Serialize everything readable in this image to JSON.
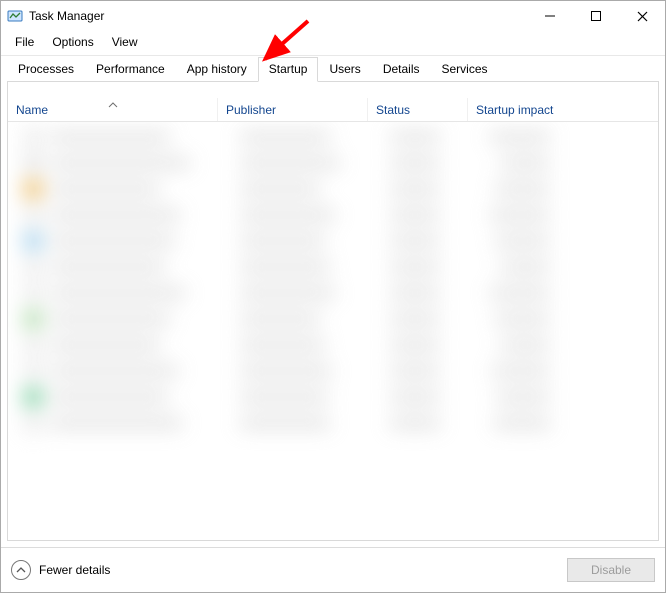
{
  "window": {
    "title": "Task Manager"
  },
  "menu": {
    "file": "File",
    "options": "Options",
    "view": "View"
  },
  "tabs": {
    "processes": "Processes",
    "performance": "Performance",
    "app_history": "App history",
    "startup": "Startup",
    "users": "Users",
    "details": "Details",
    "services": "Services",
    "active": "startup"
  },
  "columns": {
    "name": "Name",
    "publisher": "Publisher",
    "status": "Status",
    "startup_impact": "Startup impact"
  },
  "footer": {
    "fewer_details": "Fewer details",
    "disable": "Disable"
  },
  "annotation": {
    "arrow_color": "#ff0000",
    "points_to": "tab-startup"
  }
}
